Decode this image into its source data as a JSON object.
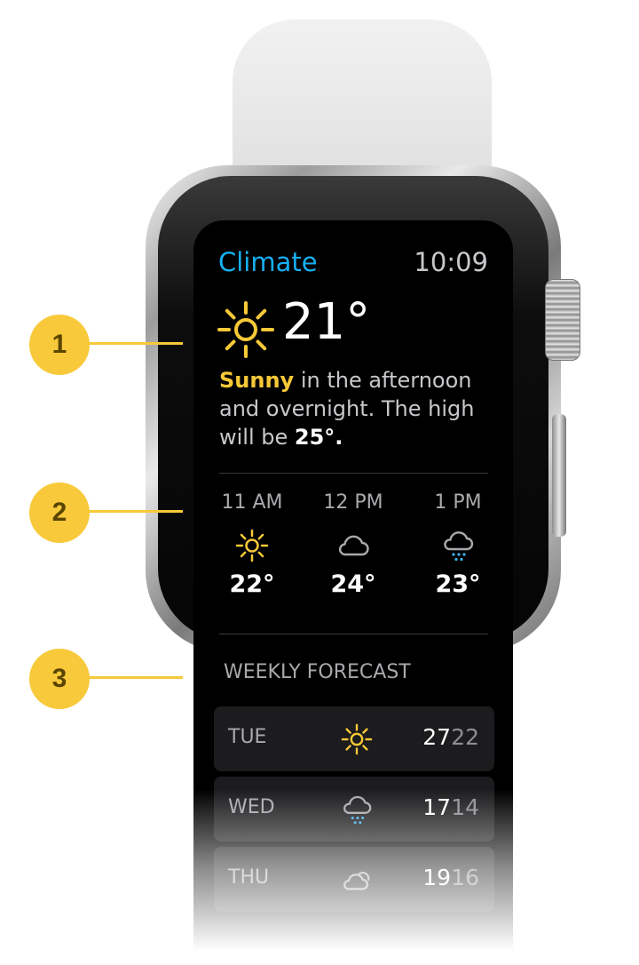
{
  "app": {
    "title": "Climate",
    "time": "10:09"
  },
  "current": {
    "temperature": "21°",
    "icon": "sun-icon",
    "summary_condition": "Sunny",
    "summary_text": " in the afternoon and overnight. The high will be ",
    "summary_high": "25°",
    "summary_end": "."
  },
  "hourly": [
    {
      "time": "11 AM",
      "icon": "sun-icon",
      "temp": "22°"
    },
    {
      "time": "12 PM",
      "icon": "cloud-icon",
      "temp": "24°"
    },
    {
      "time": "1 PM",
      "icon": "rain-cloud-icon",
      "temp": "23°"
    }
  ],
  "weekly": {
    "title": "WEEKLY FORECAST",
    "days": [
      {
        "day": "TUE",
        "icon": "sun-icon",
        "high": "27",
        "low": "22"
      },
      {
        "day": "WED",
        "icon": "rain-cloud-icon",
        "high": "17",
        "low": "14"
      },
      {
        "day": "THU",
        "icon": "partly-cloudy-icon",
        "high": "19",
        "low": "16"
      }
    ]
  },
  "callouts": [
    "1",
    "2",
    "3"
  ],
  "colors": {
    "accent_blue": "#17b0f1",
    "sun_yellow": "#f7c837",
    "rain_blue": "#3fb2ea",
    "callout": "#f8c93a"
  }
}
